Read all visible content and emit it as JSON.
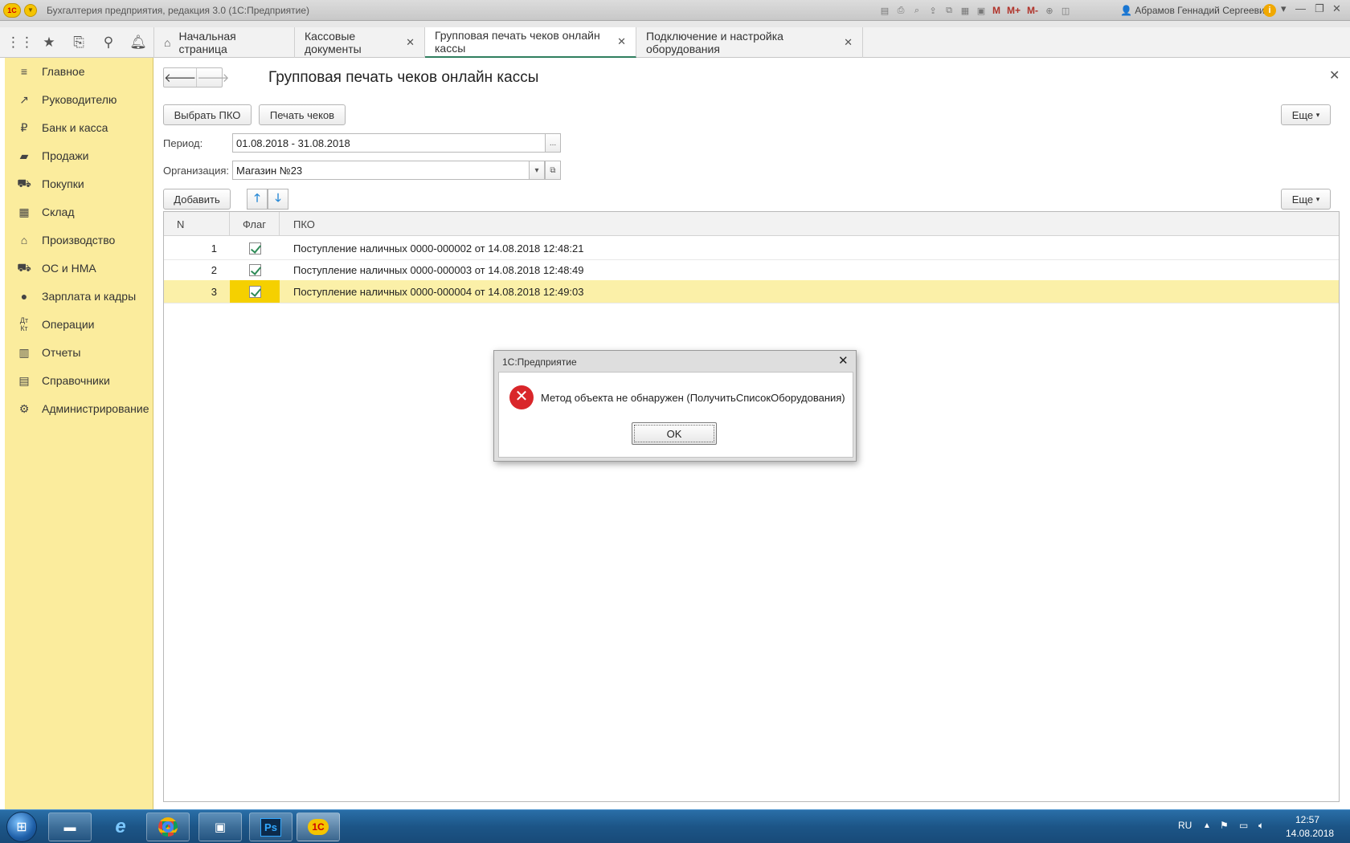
{
  "window": {
    "title": "Бухгалтерия предприятия, редакция 3.0  (1С:Предприятие)",
    "logo_text": "1С",
    "user": "Абрамов Геннадий Сергеевич",
    "toolbar_m": [
      "M",
      "M+",
      "M-"
    ]
  },
  "tabs": [
    {
      "label": "Начальная страница",
      "closable": false
    },
    {
      "label": "Кассовые документы",
      "closable": true
    },
    {
      "label": "Групповая печать чеков онлайн кассы",
      "closable": true,
      "active": true
    },
    {
      "label": "Подключение и настройка оборудования",
      "closable": true
    }
  ],
  "sidebar": {
    "items": [
      {
        "label": "Главное",
        "icon": "menu-icon"
      },
      {
        "label": "Руководителю",
        "icon": "trend-icon"
      },
      {
        "label": "Банк и касса",
        "icon": "ruble-icon"
      },
      {
        "label": "Продажи",
        "icon": "bag-icon"
      },
      {
        "label": "Покупки",
        "icon": "cart-icon"
      },
      {
        "label": "Склад",
        "icon": "warehouse-icon"
      },
      {
        "label": "Производство",
        "icon": "factory-icon"
      },
      {
        "label": "ОС и НМА",
        "icon": "truck-icon"
      },
      {
        "label": "Зарплата и кадры",
        "icon": "person-icon"
      },
      {
        "label": "Операции",
        "icon": "dt-kt-icon"
      },
      {
        "label": "Отчеты",
        "icon": "bar-chart-icon"
      },
      {
        "label": "Справочники",
        "icon": "book-icon"
      },
      {
        "label": "Администрирование",
        "icon": "gear-icon"
      }
    ]
  },
  "form": {
    "title": "Групповая печать чеков онлайн кассы",
    "btn_select": "Выбрать ПКО",
    "btn_print": "Печать чеков",
    "btn_more": "Еще",
    "period_label": "Период:",
    "period_value": "01.08.2018 - 31.08.2018",
    "org_label": "Организация:",
    "org_value": "Магазин №23",
    "btn_add": "Добавить",
    "btn_more2": "Еще"
  },
  "table": {
    "headers": {
      "n": "N",
      "flag": "Флаг",
      "pko": "ПКО"
    },
    "rows": [
      {
        "n": "1",
        "flag": true,
        "pko": "Поступление наличных 0000-000002 от 14.08.2018 12:48:21"
      },
      {
        "n": "2",
        "flag": true,
        "pko": "Поступление наличных 0000-000003 от 14.08.2018 12:48:49"
      },
      {
        "n": "3",
        "flag": true,
        "pko": "Поступление наличных 0000-000004 от 14.08.2018 12:49:03",
        "selected": true
      }
    ]
  },
  "dialog": {
    "title": "1С:Предприятие",
    "message": "Метод объекта не обнаружен (ПолучитьСписокОборудования)",
    "ok": "OK"
  },
  "taskbar": {
    "lang": "RU",
    "time": "12:57",
    "date": "14.08.2018",
    "ps_label": "Ps",
    "onec_label": "1С"
  },
  "colors": {
    "sidebar_bg": "#fbec9d",
    "selected_row": "#fbf0a8",
    "active_tab_underline": "#2f7f5f",
    "error_red": "#d9262a"
  }
}
